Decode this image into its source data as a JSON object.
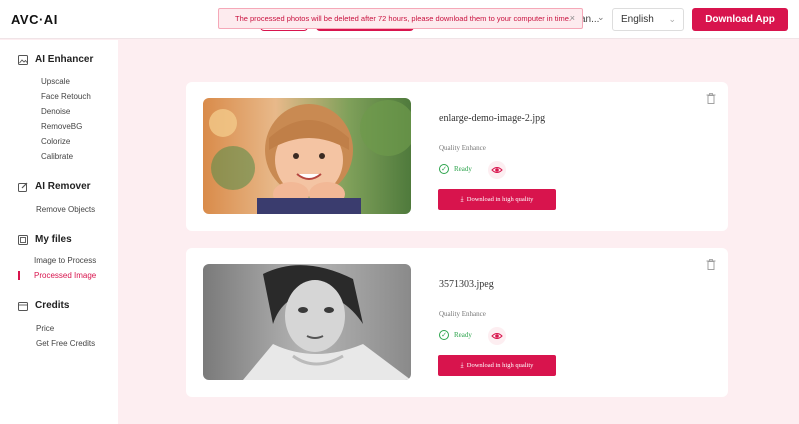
{
  "header": {
    "logo": "AVC·AI",
    "user_truncated": "an...",
    "language": "English",
    "download_app": "Download App"
  },
  "toast": {
    "message": "The processed photos will be deleted after 72 hours, please download them to your computer in time.",
    "close": "×"
  },
  "sidebar": {
    "sections": [
      {
        "title": "AI Enhancer",
        "items": [
          "Upscale",
          "Face Retouch",
          "Denoise",
          "RemoveBG",
          "Colorize",
          "Calibrate"
        ]
      },
      {
        "title": "AI Remover",
        "items": [
          "Remove Objects"
        ]
      },
      {
        "title": "My files",
        "items": [
          "Image to Process",
          "Processed Image"
        ]
      },
      {
        "title": "Credits",
        "items": [
          "Price",
          "Get Free Credits"
        ]
      }
    ],
    "active_item": "Processed Image"
  },
  "files": [
    {
      "filename": "enlarge-demo-image-2.jpg",
      "mode": "Quality Enhance",
      "status": "Ready",
      "download_label": "Download in high quality"
    },
    {
      "filename": "3571303.jpeg",
      "mode": "Quality Enhance",
      "status": "Ready",
      "download_label": "Download in high quality"
    }
  ],
  "colors": {
    "accent": "#d8144d",
    "background": "#fdeef1",
    "ready": "#2ba34b"
  }
}
